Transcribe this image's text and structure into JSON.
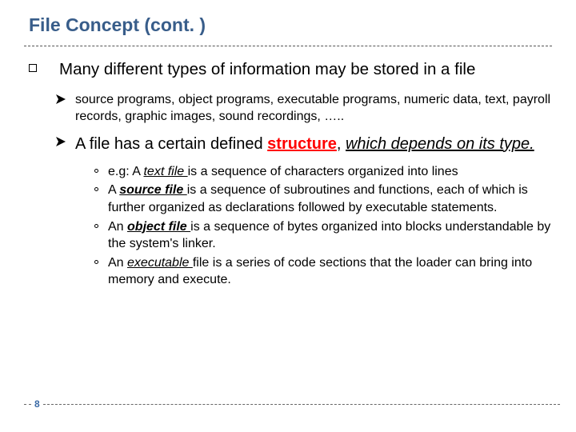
{
  "title": "File Concept (cont. )",
  "topBullet": "Many different types of information may be stored in a file",
  "arrow1": "source programs, object programs, executable programs, numeric data, text, payroll records, graphic images, sound recordings, ….. ",
  "arrow2": {
    "lead": "A file has a certain defined ",
    "structure": "structure",
    "mid": ", ",
    "depends": "which depends on its type."
  },
  "circ": {
    "c1": {
      "pre": "e.g:  A ",
      "term": "text file ",
      "rest": "is a sequence of characters organized into lines"
    },
    "c2": {
      "pre": "A ",
      "term": "source file ",
      "rest": "is a sequence of subroutines and functions, each of which is further organized as declarations followed by executable statements."
    },
    "c3": {
      "pre": "An ",
      "term": "object file ",
      "rest": "is a sequence of bytes organized into blocks understandable by the system's linker."
    },
    "c4": {
      "pre": " An ",
      "term": "executable ",
      "rest": "file is a series of code sections that the loader can bring into memory and execute."
    }
  },
  "pageNumber": "8"
}
